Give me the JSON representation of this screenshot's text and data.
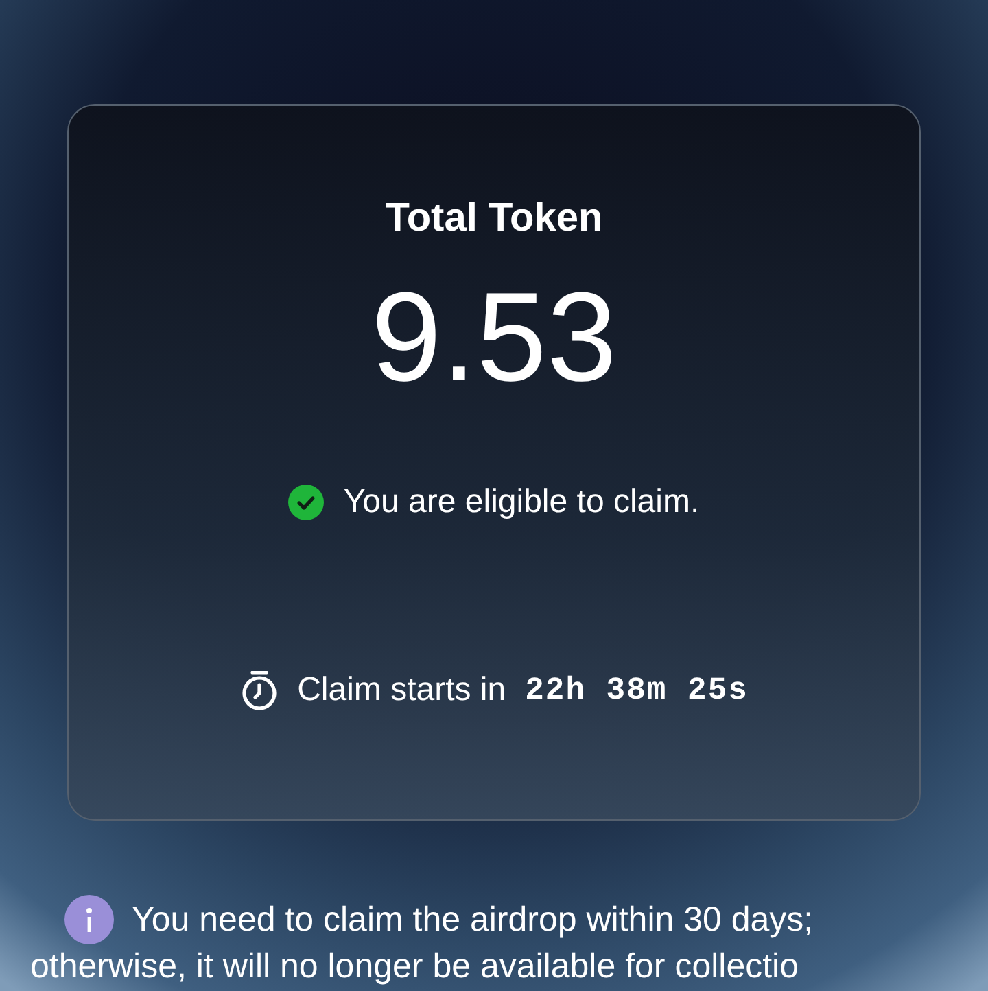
{
  "card": {
    "title": "Total Token",
    "amount": "9.53",
    "eligibility": {
      "eligible": true,
      "text": "You are eligible to claim."
    },
    "countdown": {
      "label": "Claim starts in",
      "time": "22h 38m 25s"
    }
  },
  "notice": {
    "lines": [
      "You need to claim the airdrop within 30 days;",
      "otherwise, it will no longer be available for collectio"
    ]
  }
}
